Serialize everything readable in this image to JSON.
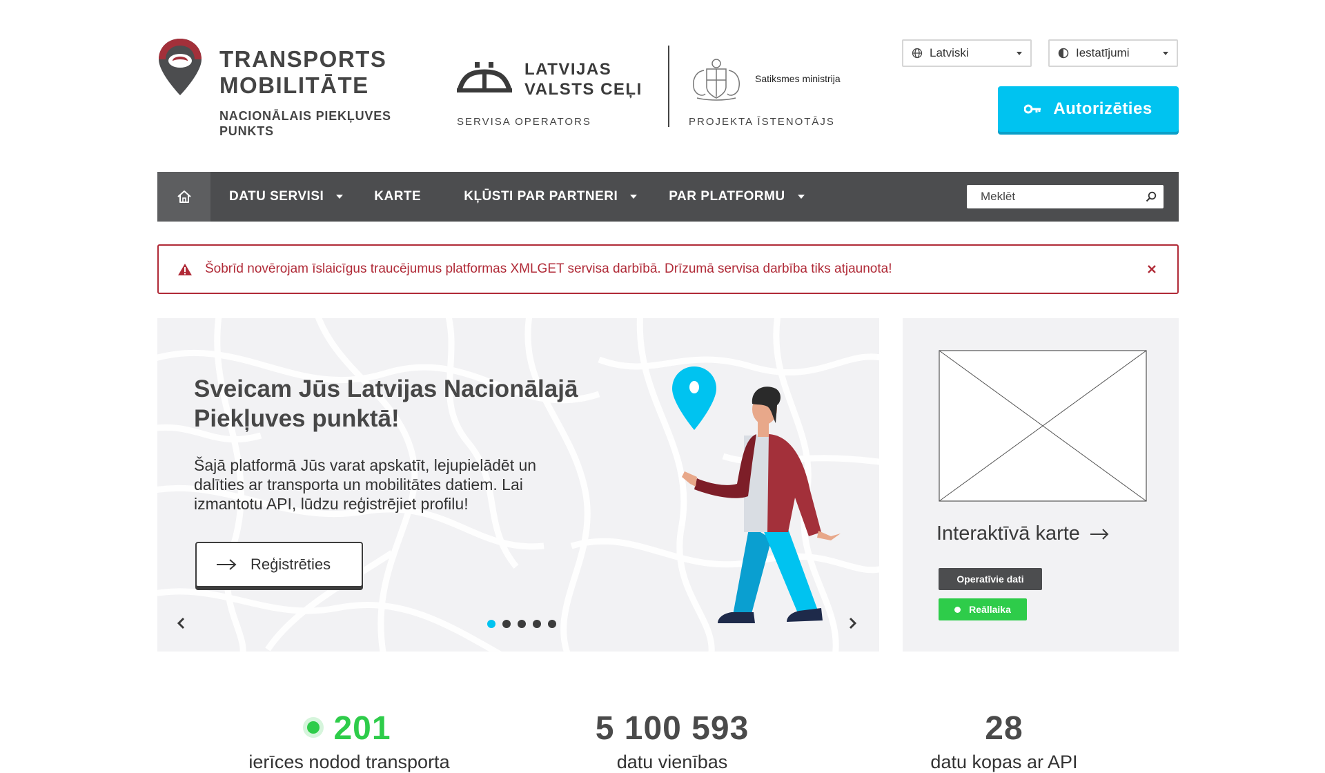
{
  "brand": {
    "title_line1": "TRANSPORTS",
    "title_line2": "MOBILITĀTE",
    "subtitle_line1": "NACIONĀLAIS PIEKĻUVES",
    "subtitle_line2": "PUNKTS"
  },
  "partners": {
    "lvc_line1": "LATVIJAS",
    "lvc_line2": "VALSTS CEĻI",
    "operator_caption": "SERVISA OPERATORS",
    "ministry_name": "Satiksmes ministrija",
    "implementer_caption": "PROJEKTA ĪSTENOTĀJS"
  },
  "header_controls": {
    "language": "Latviski",
    "settings": "Iestatījumi",
    "login": "Autorizēties"
  },
  "nav": {
    "items": [
      {
        "label": "DATU SERVISI"
      },
      {
        "label": "KARTE"
      },
      {
        "label": "KĻŪSTI PAR PARTNERI"
      },
      {
        "label": "PAR PLATFORMU"
      }
    ],
    "search_placeholder": "Meklēt"
  },
  "alert": {
    "text": "Šobrīd novērojam īslaicīgus traucējumus platformas XMLGET servisa darbībā. Drīzumā servisa darbība tiks atjaunota!"
  },
  "hero": {
    "title_line1": "Sveicam Jūs Latvijas Nacionālajā",
    "title_line2": "Piekļuves punktā!",
    "text_line1": "Šajā platformā Jūs varat apskatīt, lejupielādēt un",
    "text_line2": "dalīties ar transporta un mobilitātes datiem. Lai",
    "text_line3": "izmantotu API, lūdzu reģistrējiet profilu!",
    "register_button": "Reģistrēties",
    "slide_count": 5,
    "active_slide": 1
  },
  "map_card": {
    "title": "Interaktīvā karte",
    "tag_operative": "Operatīvie dati",
    "tag_realtime": "Reāllaika"
  },
  "stats": [
    {
      "value": "201",
      "label": "ierīces nodod transporta"
    },
    {
      "value": "5 100 593",
      "label": "datu vienības"
    },
    {
      "value": "28",
      "label": "datu kopas ar API"
    }
  ],
  "colors": {
    "accent": "#00c3f0",
    "alert": "#b02a37",
    "nav": "#4c4d4f",
    "brand_red": "#a3303a",
    "live_green": "#2ecc4a"
  }
}
